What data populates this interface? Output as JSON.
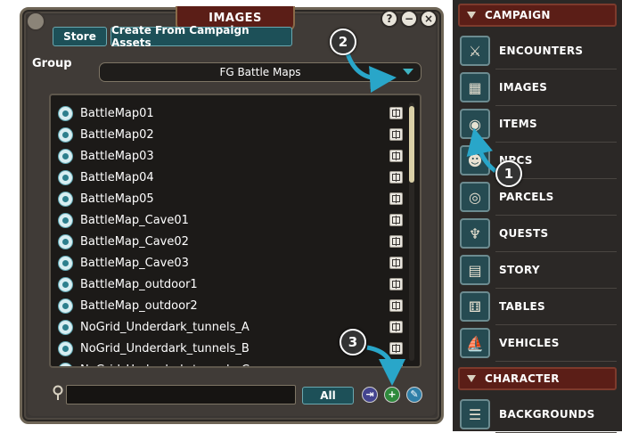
{
  "window": {
    "title": "IMAGES",
    "controls": [
      "?",
      "−",
      "×"
    ],
    "tabs": {
      "store": "Store",
      "campaign_assets": "Create From Campaign Assets"
    },
    "group": {
      "label": "Group",
      "value": "FG Battle Maps"
    },
    "items": [
      "BattleMap01",
      "BattleMap02",
      "BattleMap03",
      "BattleMap04",
      "BattleMap05",
      "BattleMap_Cave01",
      "BattleMap_Cave02",
      "BattleMap_Cave03",
      "BattleMap_outdoor1",
      "BattleMap_outdoor2",
      "NoGrid_Underdark_tunnels_A",
      "NoGrid_Underdark_tunnels_B",
      "NoGrid_Underdark_tunnels_C"
    ],
    "filter": {
      "all_label": "All",
      "search_value": ""
    },
    "buttons": {
      "add_symbol": "+",
      "import_symbol": "⇥",
      "edit_symbol": "✎"
    }
  },
  "sidebar": {
    "campaign_header": "CAMPAIGN",
    "campaign_items": [
      {
        "label": "ENCOUNTERS",
        "icon": "encounters-icon"
      },
      {
        "label": "IMAGES",
        "icon": "images-icon"
      },
      {
        "label": "ITEMS",
        "icon": "items-icon"
      },
      {
        "label": "NPCS",
        "icon": "npcs-icon"
      },
      {
        "label": "PARCELS",
        "icon": "parcels-icon"
      },
      {
        "label": "QUESTS",
        "icon": "quests-icon"
      },
      {
        "label": "STORY",
        "icon": "story-icon"
      },
      {
        "label": "TABLES",
        "icon": "tables-icon"
      },
      {
        "label": "VEHICLES",
        "icon": "vehicles-icon"
      }
    ],
    "character_header": "CHARACTER",
    "character_items": [
      {
        "label": "BACKGROUNDS",
        "icon": "backgrounds-icon"
      }
    ]
  },
  "annotations": [
    "1",
    "2",
    "3"
  ],
  "colors": {
    "accent_teal": "#1d5058",
    "title_red": "#5b1e17",
    "annotation_arrow": "#29a6c9"
  }
}
